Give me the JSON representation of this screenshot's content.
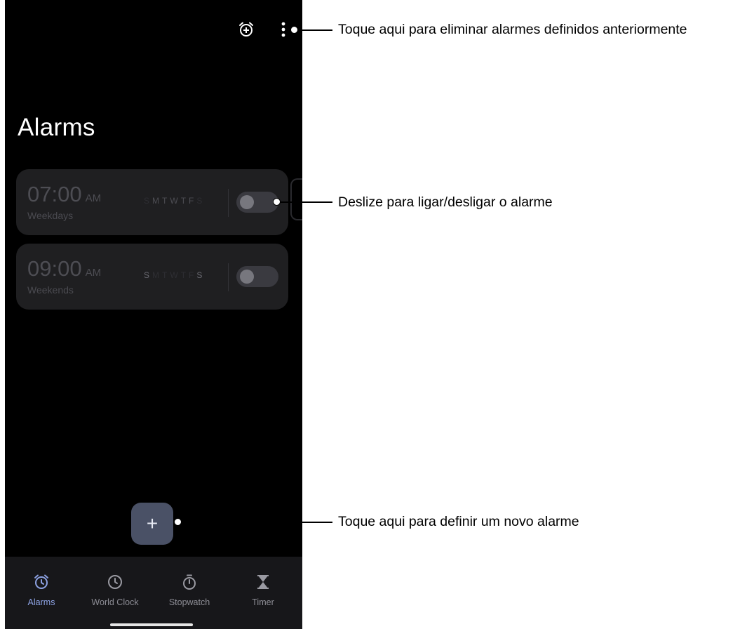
{
  "title": "Alarms",
  "alarms": [
    {
      "time": "07:00",
      "ampm": "AM",
      "label": "Weekdays",
      "days": [
        "S",
        "M",
        "T",
        "W",
        "T",
        "F",
        "S"
      ],
      "enabled": false
    },
    {
      "time": "09:00",
      "ampm": "AM",
      "label": "Weekends",
      "days": [
        "S",
        "M",
        "T",
        "W",
        "T",
        "F",
        "S"
      ],
      "enabled": false
    }
  ],
  "fab_label": "+",
  "nav": [
    {
      "label": "Alarms",
      "icon": "alarm-clock-icon",
      "active": true
    },
    {
      "label": "World Clock",
      "icon": "clock-icon",
      "active": false
    },
    {
      "label": "Stopwatch",
      "icon": "stopwatch-icon",
      "active": false
    },
    {
      "label": "Timer",
      "icon": "hourglass-icon",
      "active": false
    }
  ],
  "callouts": {
    "menu": "Toque aqui para eliminar alarmes definidos anteriormente",
    "toggle": "Deslize para ligar/desligar o alarme",
    "add": "Toque aqui para definir um novo alarme"
  },
  "colors": {
    "accent": "#8da2e3",
    "fab": "#4a5166",
    "background": "#000000",
    "card": "#1f1f21"
  }
}
